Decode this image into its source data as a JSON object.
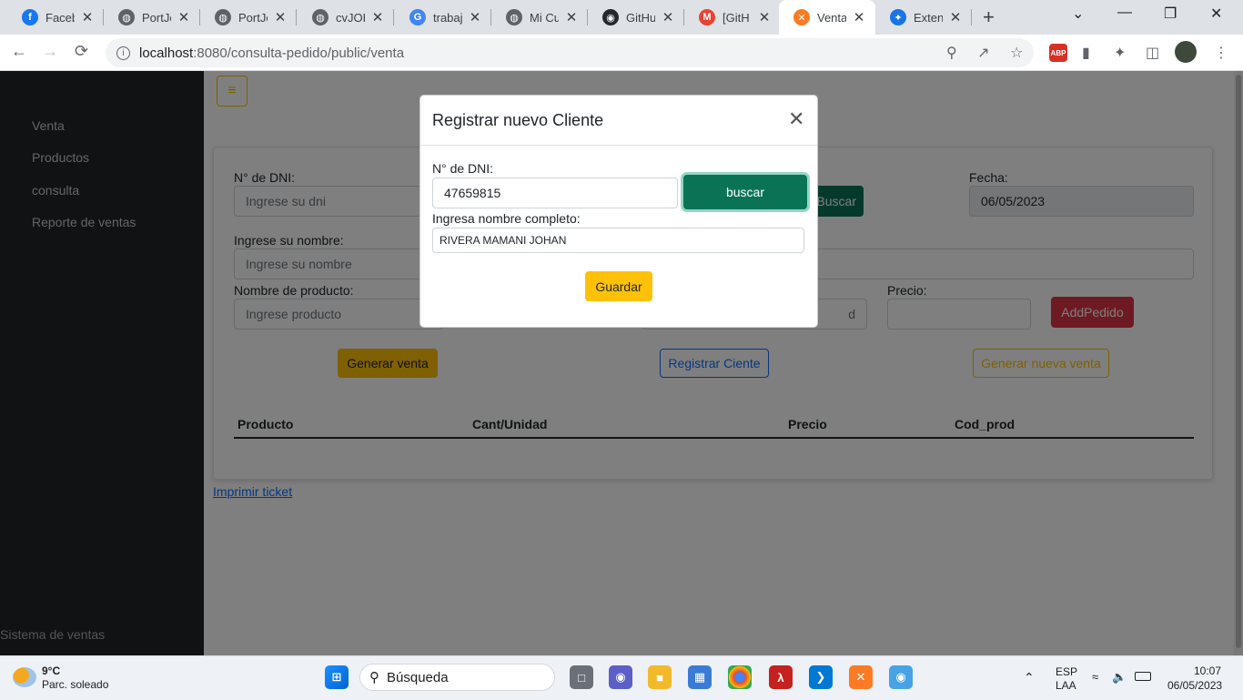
{
  "browser": {
    "tabs": [
      {
        "title": "Facebo",
        "icon": "facebook-icon",
        "color": "#1877f2",
        "glyph": "f"
      },
      {
        "title": "PortJo",
        "icon": "globe-icon",
        "color": "#5f6368",
        "glyph": "◍"
      },
      {
        "title": "PortJo",
        "icon": "globe-icon",
        "color": "#5f6368",
        "glyph": "◍"
      },
      {
        "title": "cvJOH",
        "icon": "globe-icon",
        "color": "#5f6368",
        "glyph": "◍"
      },
      {
        "title": "trabaj",
        "icon": "google-icon",
        "color": "#4285f4",
        "glyph": "G"
      },
      {
        "title": "Mi Cu",
        "icon": "globe-icon",
        "color": "#5f6368",
        "glyph": "◍"
      },
      {
        "title": "GitHu",
        "icon": "github-icon",
        "color": "#24292f",
        "glyph": "◉"
      },
      {
        "title": "[GitH",
        "icon": "gmail-icon",
        "color": "#ea4335",
        "glyph": "M"
      },
      {
        "title": "Venta",
        "icon": "xampp-icon",
        "color": "#fb7a24",
        "glyph": "✕",
        "active": true
      },
      {
        "title": "Extens",
        "icon": "puzzle-icon",
        "color": "#1a73e8",
        "glyph": "✦"
      }
    ],
    "new_tab": "+",
    "url_host": "localhost",
    "url_path": ":8080/consulta-pedido/public/venta"
  },
  "sidebar": {
    "items": [
      "Venta",
      "Productos",
      "consulta",
      "Reporte de ventas"
    ],
    "footer": "Sistema de ventas"
  },
  "form": {
    "dni_label": "N° de DNI:",
    "dni_placeholder": "Ingrese su dni",
    "buscar_label": "Buscar",
    "fecha_label": "Fecha:",
    "fecha_value": "06/05/2023",
    "nombre_label": "Ingrese su nombre:",
    "nombre_placeholder": "Ingrese su nombre",
    "producto_label": "Nombre de producto:",
    "producto_placeholder": "Ingrese producto",
    "cantidad_partial": "d",
    "precio_label": "Precio:",
    "addpedido_label": "AddPedido",
    "generar_venta": "Generar venta",
    "registrar_cliente": "Registrar Ciente",
    "generar_nueva_venta": "Generar nueva venta",
    "menu_glyph": "≡"
  },
  "table": {
    "headers": [
      "Producto",
      "Cant/Unidad",
      "Precio",
      "Cod_prod"
    ]
  },
  "print_link": "Imprimir ticket",
  "modal": {
    "title": "Registrar nuevo Cliente",
    "dni_label": "N° de DNI:",
    "dni_value": "47659815",
    "buscar_label": "buscar",
    "nombre_label": "Ingresa nombre completo:",
    "nombre_value": "RIVERA MAMANI JOHAN",
    "guardar_label": "Guardar"
  },
  "taskbar": {
    "temperature": "9°C",
    "weather": "Parc. soleado",
    "search": "Búsqueda",
    "lang1": "ESP",
    "lang2": "LAA",
    "time": "10:07",
    "date": "06/05/2023"
  },
  "colors": {
    "success": "#0a7356",
    "warning": "#ffc107",
    "danger": "#dc3545",
    "primary": "#0d6efd",
    "sidebar": "#212529"
  }
}
